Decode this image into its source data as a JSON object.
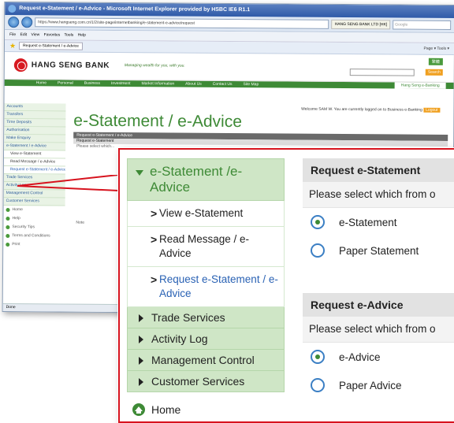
{
  "browser": {
    "title": "Request e-Statement / e-Advice - Microsoft Internet Explorer provided by HSBC IE6 R1.1",
    "address": "https://www.hangseng.com.cn/1/2/site-page/internetbanking/e-statement-e-advice/request",
    "address_tab": "HANG SENG BANK LTD [HK]",
    "search_placeholder": "Google",
    "menu": "File  Edit  View  Favorites  Tools  Help",
    "fav_tab": "Request e-Statement / e-Advice",
    "fav_tools": "Page ▾  Tools ▾",
    "status": "Done"
  },
  "bank": {
    "name": "HANG SENG BANK",
    "tagline": "Managing wealth for you, with you.",
    "lang_button": "繁體",
    "search_button": "Search",
    "nav": [
      "Home",
      "Personal",
      "Business",
      "Investment",
      "Market Information",
      "About Us",
      "Contact Us",
      "Site Map"
    ],
    "nav_right": "Hang Seng e-Banking",
    "welcome": "Welcome SAM W. You are currently logged on to Business e-Banking",
    "logout": "Logout",
    "page_title": "e-Statement  / e-Advice",
    "breadcrumb": "Request e-Statement / e-Advice",
    "sub_title": "Request e-Statement",
    "instr": "Please select which...",
    "note": "Note"
  },
  "sidebar_small": {
    "items": [
      "Accounts",
      "Transfers",
      "Time Deposits",
      "Authorisation",
      "Make Enquiry",
      "e-Statement / e-Advice"
    ],
    "subs": [
      "View e-Statement",
      "Read Message / e-Advice",
      "Request e-Statement / e-Advice"
    ],
    "items2": [
      "Trade Services",
      "Activity Log",
      "Management Control",
      "Customer Services"
    ],
    "links": [
      "Home",
      "Help",
      "Security Tips",
      "Terms and Conditions",
      "Print"
    ]
  },
  "zoom": {
    "menu_header": "e-Statement /e-Advice",
    "sub_items": [
      "View e-Statement",
      "Read Message / e-Advice",
      "Request e-Statement / e-Advice"
    ],
    "sections": [
      "Trade Services",
      "Activity Log",
      "Management Control",
      "Customer Services"
    ],
    "home": "Home",
    "estatement": {
      "title": "Request e-Statement",
      "instruction": "Please select which from o",
      "options": [
        "e-Statement",
        "Paper Statement"
      ],
      "selected": "e-Statement"
    },
    "eadvice": {
      "title": "Request e-Advice",
      "instruction": "Please select which from o",
      "options": [
        "e-Advice",
        "Paper Advice"
      ],
      "selected": "e-Advice"
    }
  },
  "colors": {
    "accent_green": "#3e8a36",
    "menu_green": "#cfe6c6",
    "callout_red": "#d7131e",
    "link_blue": "#2a62b4"
  }
}
